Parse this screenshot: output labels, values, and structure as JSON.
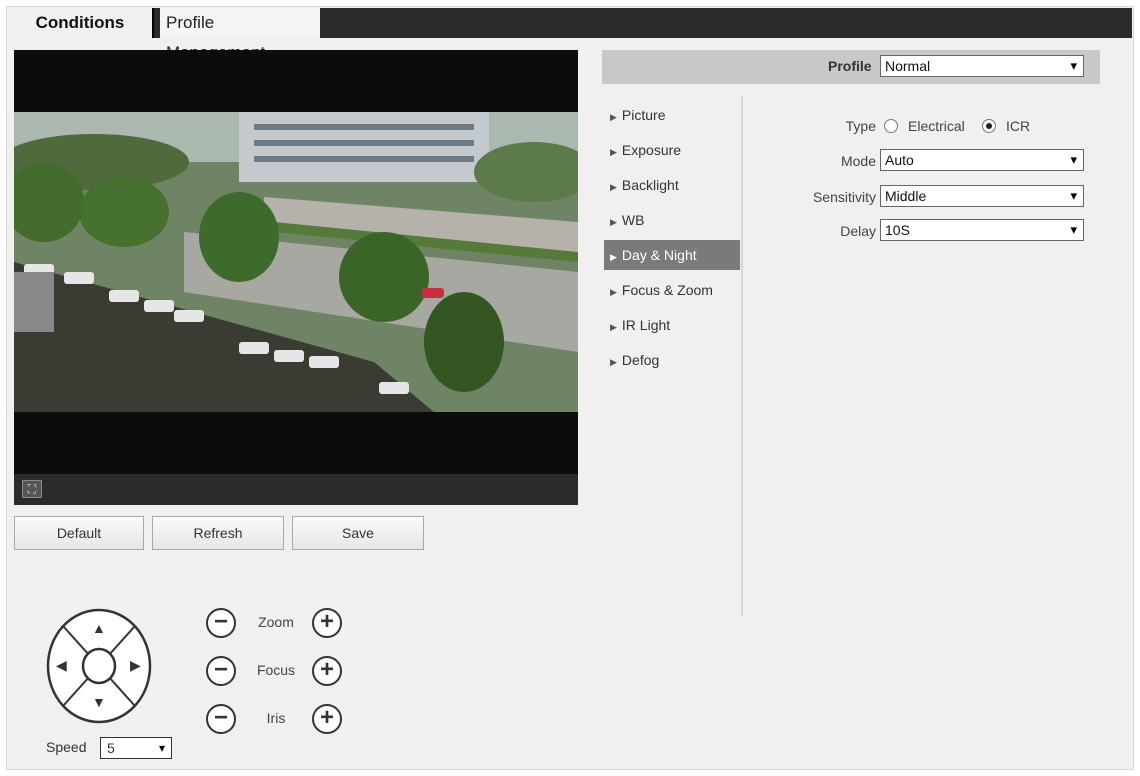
{
  "tabs": {
    "active": "Conditions",
    "inactive": "Profile Management"
  },
  "buttons": {
    "default": "Default",
    "refresh": "Refresh",
    "save": "Save"
  },
  "ptz": {
    "rows": [
      {
        "label": "Zoom",
        "minus": "−",
        "plus": "+"
      },
      {
        "label": "Focus",
        "minus": "−",
        "plus": "+"
      },
      {
        "label": "Iris",
        "minus": "−",
        "plus": "+"
      }
    ],
    "speed_label": "Speed",
    "speed_value": "5",
    "direction_icons": {
      "up": "▲",
      "down": "▼",
      "left": "◀",
      "right": "▶"
    }
  },
  "profile": {
    "label": "Profile",
    "value": "Normal"
  },
  "menu": {
    "items": [
      {
        "label": "Picture"
      },
      {
        "label": "Exposure"
      },
      {
        "label": "Backlight"
      },
      {
        "label": "WB"
      },
      {
        "label": "Day & Night"
      },
      {
        "label": "Focus & Zoom"
      },
      {
        "label": "IR Light"
      },
      {
        "label": "Defog"
      }
    ],
    "active_index": 4
  },
  "settings": {
    "type_label": "Type",
    "type_options": [
      {
        "label": "Electrical",
        "selected": false
      },
      {
        "label": "ICR",
        "selected": true
      }
    ],
    "mode_label": "Mode",
    "mode_value": "Auto",
    "sensitivity_label": "Sensitivity",
    "sensitivity_value": "Middle",
    "delay_label": "Delay",
    "delay_value": "10S"
  },
  "icons": {
    "fullscreen": "fullscreen-icon",
    "chevron": "▾",
    "menu_triangle": "▶"
  },
  "colors": {
    "tab_bar": "#2b2b2b",
    "active_menu": "#7a7a7a",
    "profile_bar": "#c8c8c8"
  }
}
